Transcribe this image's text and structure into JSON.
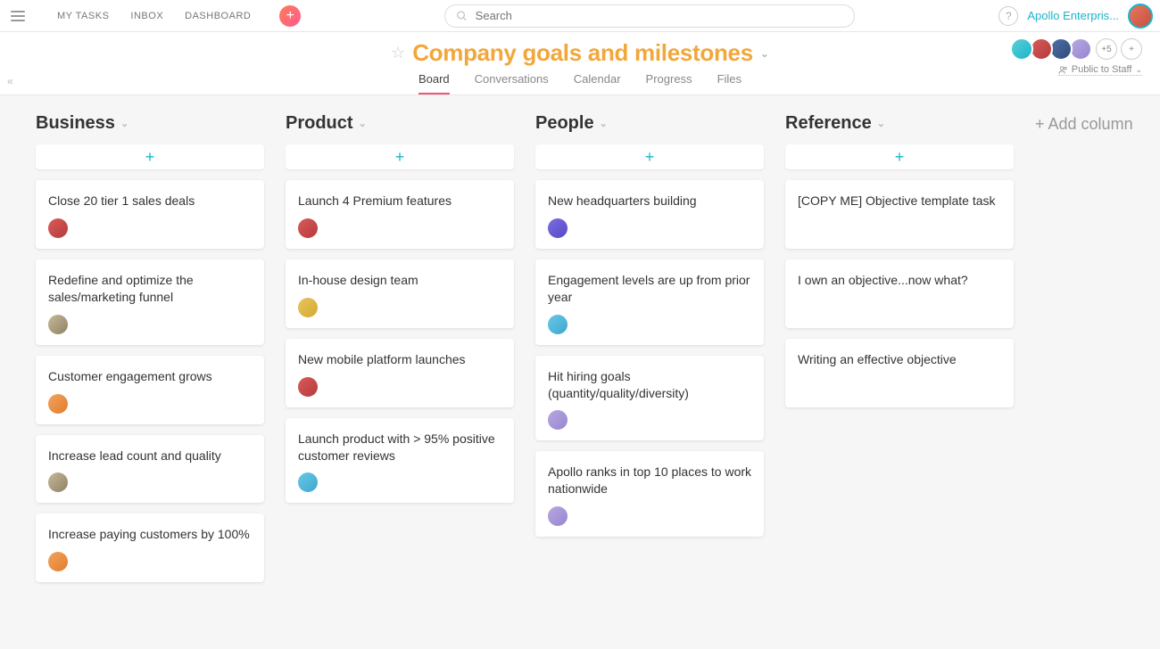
{
  "topbar": {
    "nav": [
      "MY TASKS",
      "INBOX",
      "DASHBOARD"
    ],
    "search_placeholder": "Search",
    "org_name": "Apollo Enterpris..."
  },
  "header": {
    "title": "Company goals and milestones",
    "tabs": [
      "Board",
      "Conversations",
      "Calendar",
      "Progress",
      "Files"
    ],
    "active_tab": 0,
    "privacy_label": "Public to Staff",
    "overflow_count": "+5",
    "add_member": "+"
  },
  "board": {
    "columns": [
      {
        "title": "Business",
        "cards": [
          {
            "title": "Close 20 tier 1 sales deals",
            "avatar": "av-red"
          },
          {
            "title": "Redefine and optimize the sales/marketing funnel",
            "avatar": "av-dog"
          },
          {
            "title": "Customer engagement grows",
            "avatar": "av-orange"
          },
          {
            "title": "Increase lead count and quality",
            "avatar": "av-dog"
          },
          {
            "title": "Increase paying customers by 100%",
            "avatar": "av-orange"
          }
        ]
      },
      {
        "title": "Product",
        "cards": [
          {
            "title": "Launch 4 Premium features",
            "avatar": "av-red"
          },
          {
            "title": "In-house design team",
            "avatar": "av-gold"
          },
          {
            "title": "New mobile platform launches",
            "avatar": "av-red"
          },
          {
            "title": "Launch product with > 95% positive customer reviews",
            "avatar": "av-cyan"
          }
        ]
      },
      {
        "title": "People",
        "cards": [
          {
            "title": "New headquarters building",
            "avatar": "av-purple"
          },
          {
            "title": "Engagement levels are up from prior year",
            "avatar": "av-cyan"
          },
          {
            "title": "Hit hiring goals (quantity/quality/diversity)",
            "avatar": "av-lav"
          },
          {
            "title": "Apollo ranks in top 10 places to work nationwide",
            "avatar": "av-lav"
          }
        ]
      },
      {
        "title": "Reference",
        "cards": [
          {
            "title": "[COPY ME] Objective template task"
          },
          {
            "title": "I own an objective...now what?"
          },
          {
            "title": "Writing an effective objective"
          }
        ]
      }
    ],
    "add_column_label": "+ Add column"
  }
}
